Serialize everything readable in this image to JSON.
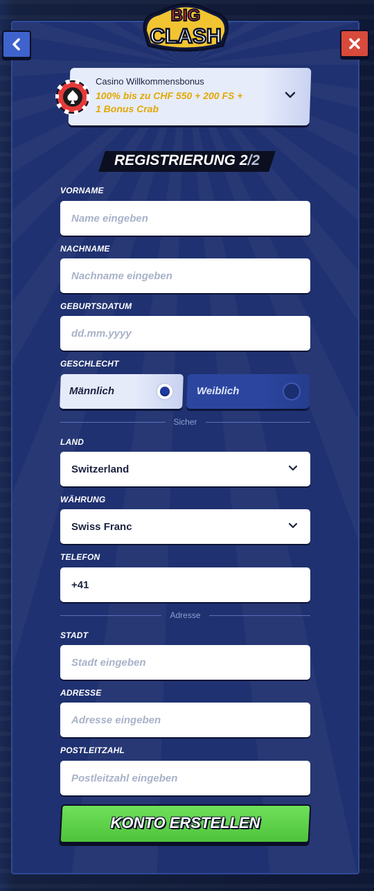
{
  "brand": {
    "logo_text": "BIG CLASH"
  },
  "nav": {
    "back_icon": "chevron-left-icon",
    "close_icon": "close-icon"
  },
  "bonus": {
    "title": "Casino Willkommensbonus",
    "line1": "100% bis zu CHF 550 + 200 FS +",
    "line2": "1 Bonus Crab",
    "icon": "casino-chip-icon"
  },
  "registration": {
    "title": "REGISTRIERUNG 2",
    "step_suffix": "/2"
  },
  "fields": {
    "first_name": {
      "label": "VORNAME",
      "placeholder": "Name eingeben"
    },
    "last_name": {
      "label": "NACHNAME",
      "placeholder": "Nachname eingeben"
    },
    "birthdate": {
      "label": "GEBURTSDATUM",
      "placeholder": "dd.mm.yyyy"
    },
    "gender": {
      "label": "GESCHLECHT",
      "options": [
        "Männlich",
        "Weiblich"
      ],
      "selected": "Männlich"
    },
    "country": {
      "label": "LAND",
      "value": "Switzerland"
    },
    "currency": {
      "label": "WÄHRUNG",
      "value": "Swiss Franc"
    },
    "phone": {
      "label": "TELEFON",
      "value": "+41"
    },
    "city": {
      "label": "STADT",
      "placeholder": "Stadt eingeben"
    },
    "address": {
      "label": "ADRESSE",
      "placeholder": "Adresse eingeben"
    },
    "zip": {
      "label": "POSTLEITZAHL",
      "placeholder": "Postleitzahl eingeben"
    }
  },
  "dividers": {
    "secure": "Sicher",
    "address": "Adresse"
  },
  "submit": {
    "label": "KONTO ERSTELLEN"
  },
  "colors": {
    "panel": "#1f3170",
    "accent_green": "#4fc33c",
    "close_red": "#d84a3b",
    "bonus_gold": "#e2a800"
  }
}
